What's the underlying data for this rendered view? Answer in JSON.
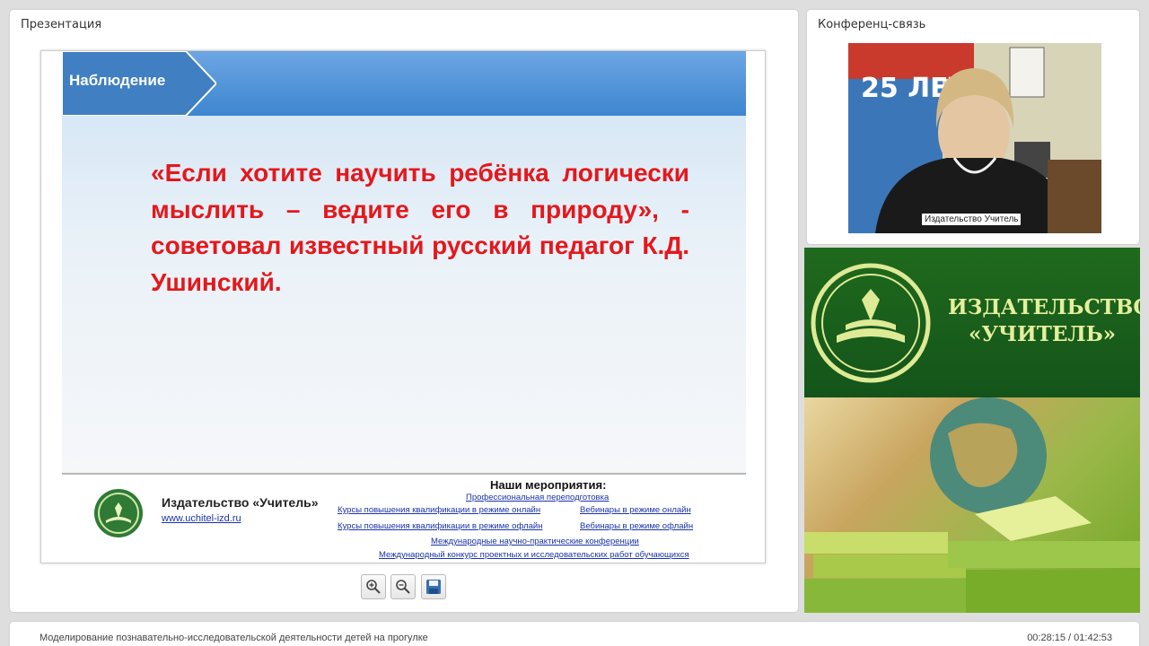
{
  "presentation": {
    "panel_title": "Презентация",
    "slide": {
      "header_label": "Наблюдение",
      "quote": "«Если хотите научить ребёнка логически мыслить – ведите его в природу», - советовал известный русский педагог К.Д. Ушинский.",
      "publisher_name": "Издательство «Учитель»",
      "publisher_site": "www.uchitel-izd.ru",
      "events_title": "Наши мероприятия:",
      "events": [
        "Профессиональная переподготовка",
        "Курсы повышения квалификации в режиме онлайн",
        "Вебинары в режиме онлайн",
        "Курсы повышения квалификации в режиме офлайн",
        "Вебинары в режиме офлайн",
        "Международные научно-практические конференции",
        "Международный конкурс проектных и исследовательских работ обучающихся"
      ]
    },
    "toolbar": [
      "zoom-in-icon",
      "zoom-out-icon",
      "save-icon"
    ]
  },
  "conference": {
    "panel_title": "Конференц-связь",
    "video_caption": "Издательство Учитель"
  },
  "ad": {
    "line1": "ИЗДАТЕЛЬСТВО",
    "line2": "«УЧИТЕЛЬ»"
  },
  "footer": {
    "title": "Моделирование познавательно-исследовательской деятельности детей на прогулке",
    "time": "00:28:15 / 01:42:53"
  },
  "colors": {
    "quote": "#e4181c",
    "header_blue": "#4a8fd6",
    "ad_green": "#1b621c",
    "link": "#1a33aa"
  }
}
